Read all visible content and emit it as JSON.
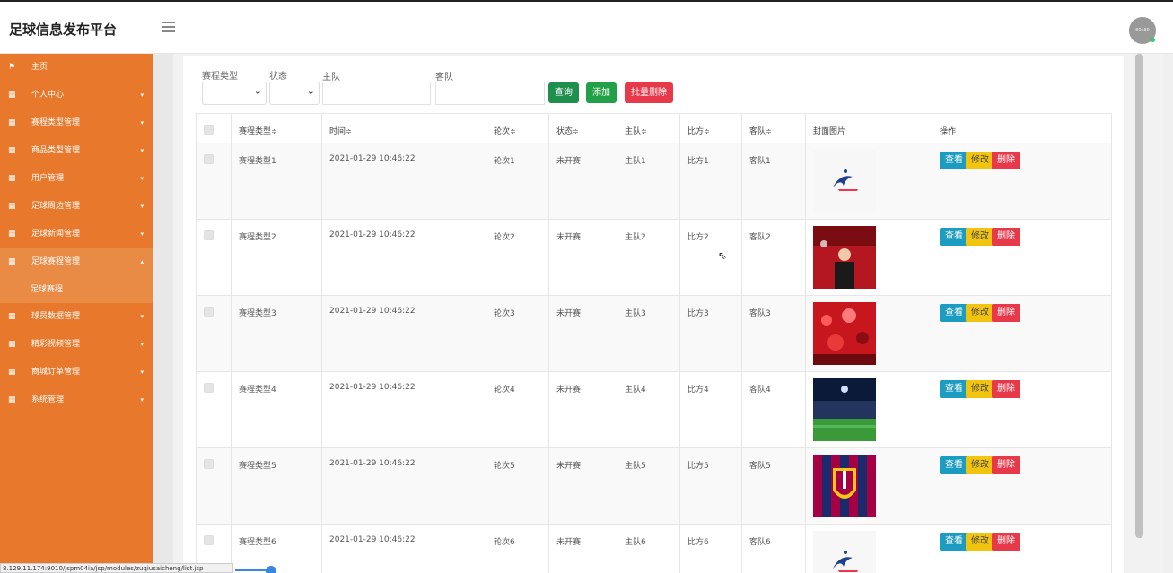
{
  "app": {
    "title": "足球信息发布平台",
    "avatar_text": "80x80"
  },
  "sidebar": {
    "items": [
      {
        "label": "主页",
        "icon": "flag-icon"
      },
      {
        "label": "个人中心",
        "icon": "grid-icon"
      },
      {
        "label": "赛程类型管理",
        "icon": "grid-icon"
      },
      {
        "label": "商品类型管理",
        "icon": "grid-icon"
      },
      {
        "label": "用户管理",
        "icon": "grid-icon"
      },
      {
        "label": "足球周边管理",
        "icon": "grid-icon"
      },
      {
        "label": "足球新闻管理",
        "icon": "grid-icon"
      },
      {
        "label": "足球赛程管理",
        "icon": "grid-icon",
        "expanded": true
      },
      {
        "label": "球员数据管理",
        "icon": "grid-icon"
      },
      {
        "label": "精彩视频管理",
        "icon": "grid-icon"
      },
      {
        "label": "商城订单管理",
        "icon": "grid-icon"
      },
      {
        "label": "系统管理",
        "icon": "grid-icon"
      }
    ],
    "subitem": "足球赛程"
  },
  "filters": {
    "type_label": "赛程类型",
    "status_label": "状态",
    "home_label": "主队",
    "away_label": "客队",
    "query_btn": "查询",
    "add_btn": "添加",
    "batch_delete_btn": "批量删除"
  },
  "table": {
    "headers": {
      "type": "赛程类型",
      "time": "时间",
      "round": "轮次",
      "status": "状态",
      "home": "主队",
      "score": "比方",
      "away": "客队",
      "cover": "封面图片",
      "ops": "操作"
    },
    "sort_glyph": "≑",
    "ops": {
      "view": "查看",
      "edit": "修改",
      "delete": "删除"
    },
    "rows": [
      {
        "type": "赛程类型1",
        "time": "2021-01-29 10:46:22",
        "round": "轮次1",
        "status": "未开赛",
        "home": "主队1",
        "score": "比方1",
        "away": "客队1",
        "cover": "france-logo"
      },
      {
        "type": "赛程类型2",
        "time": "2021-01-29 10:46:22",
        "round": "轮次2",
        "status": "未开赛",
        "home": "主队2",
        "score": "比方2",
        "away": "客队2",
        "cover": "red-coach-photo"
      },
      {
        "type": "赛程类型3",
        "time": "2021-01-29 10:46:22",
        "round": "轮次3",
        "status": "未开赛",
        "home": "主队3",
        "score": "比方3",
        "away": "客队3",
        "cover": "red-crowd-photo"
      },
      {
        "type": "赛程类型4",
        "time": "2021-01-29 10:46:22",
        "round": "轮次4",
        "status": "未开赛",
        "home": "主队4",
        "score": "比方4",
        "away": "客队4",
        "cover": "stadium-photo"
      },
      {
        "type": "赛程类型5",
        "time": "2021-01-29 10:46:22",
        "round": "轮次5",
        "status": "未开赛",
        "home": "主队5",
        "score": "比方5",
        "away": "客队5",
        "cover": "barcelona-crest"
      },
      {
        "type": "赛程类型6",
        "time": "2021-01-29 10:46:22",
        "round": "轮次6",
        "status": "未开赛",
        "home": "主队6",
        "score": "比方6",
        "away": "客队6",
        "cover": "france-logo"
      }
    ]
  },
  "status_bar": {
    "url": "8.129.11.174:9010/jspm04ia/jsp/modules/zuqiusaicheng/list.jsp"
  },
  "colors": {
    "sidebar": "#e8782b",
    "view": "#1c9cc0",
    "edit": "#f1c40f",
    "delete": "#e8394a"
  }
}
